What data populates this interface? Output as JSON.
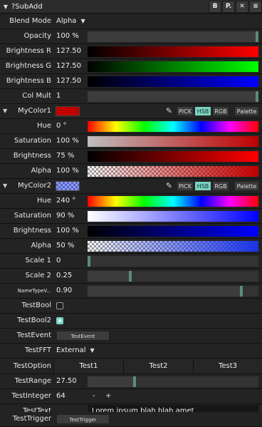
{
  "window": {
    "title": "?SubAdd",
    "buttons": [
      "B",
      "P.",
      "✕",
      "≡"
    ]
  },
  "rows": {
    "blend": {
      "label": "Blend Mode",
      "value": "Alpha"
    },
    "opacity": {
      "label": "Opacity",
      "value": "100 %",
      "level": 1.0
    },
    "brightR": {
      "label": "Brightness R",
      "value": "127.50",
      "level": 0.5
    },
    "brightG": {
      "label": "Brightness G",
      "value": "127.50",
      "level": 0.5
    },
    "brightB": {
      "label": "Brightness B",
      "value": "127.50",
      "level": 0.5
    },
    "colmult": {
      "label": "Col Mult",
      "value": "1",
      "level": 1.0
    },
    "color1": {
      "label": "MyColor1",
      "swatch": "#c00000",
      "modes": [
        "PICK",
        "HSB",
        "RGB"
      ],
      "active_mode": "HSB",
      "palette": "Palette",
      "hue": {
        "label": "Hue",
        "value": "0 °",
        "level": 0.0
      },
      "saturation": {
        "label": "Saturation",
        "value": "100 %",
        "level": 1.0
      },
      "brightness": {
        "label": "Brightness",
        "value": "75 %",
        "level": 0.75
      },
      "alpha": {
        "label": "Alpha",
        "value": "100 %",
        "level": 1.0
      }
    },
    "color2": {
      "label": "MyColor2",
      "swatch": "#1a33e6",
      "modes": [
        "PICK",
        "HSB",
        "RGB"
      ],
      "active_mode": "HSB",
      "palette": "Palette",
      "hue": {
        "label": "Hue",
        "value": "240 °",
        "level": 0.667
      },
      "saturation": {
        "label": "Saturation",
        "value": "90 %",
        "level": 0.9
      },
      "brightness": {
        "label": "Brightness",
        "value": "100 %",
        "level": 1.0
      },
      "alpha": {
        "label": "Alpha",
        "value": "50 %",
        "level": 0.5
      }
    },
    "scale1": {
      "label": "Scale 1",
      "value": "0",
      "level": 0.0
    },
    "scale2": {
      "label": "Scale 2",
      "value": "0.25",
      "level": 0.25
    },
    "nametype": {
      "label": "NameTypeV...",
      "value": "0.90",
      "level": 0.9
    },
    "testbool": {
      "label": "TestBool",
      "checked": false
    },
    "testbool2": {
      "label": "TestBool2",
      "checked": true
    },
    "testevent": {
      "label": "TestEvent",
      "button": "TestEvent"
    },
    "testfft": {
      "label": "TestFFT",
      "value": "External"
    },
    "testoption": {
      "label": "TestOption",
      "options": [
        "Test1",
        "Test2",
        "Test3"
      ]
    },
    "testrange": {
      "label": "TestRange",
      "value": "27.50",
      "level": 0.275
    },
    "testinteger": {
      "label": "TestInteger",
      "value": "64",
      "minus": "-",
      "plus": "+"
    },
    "testtext": {
      "label": "TestText",
      "value": "Lorem ipsum blah blah amet"
    },
    "testtrigger": {
      "label": "TestTrigger",
      "button": "TestTrigger"
    }
  },
  "colors": {
    "accent": "#7ad3c3",
    "handle": "#5c8c7c",
    "background": "#1b1b1b"
  }
}
